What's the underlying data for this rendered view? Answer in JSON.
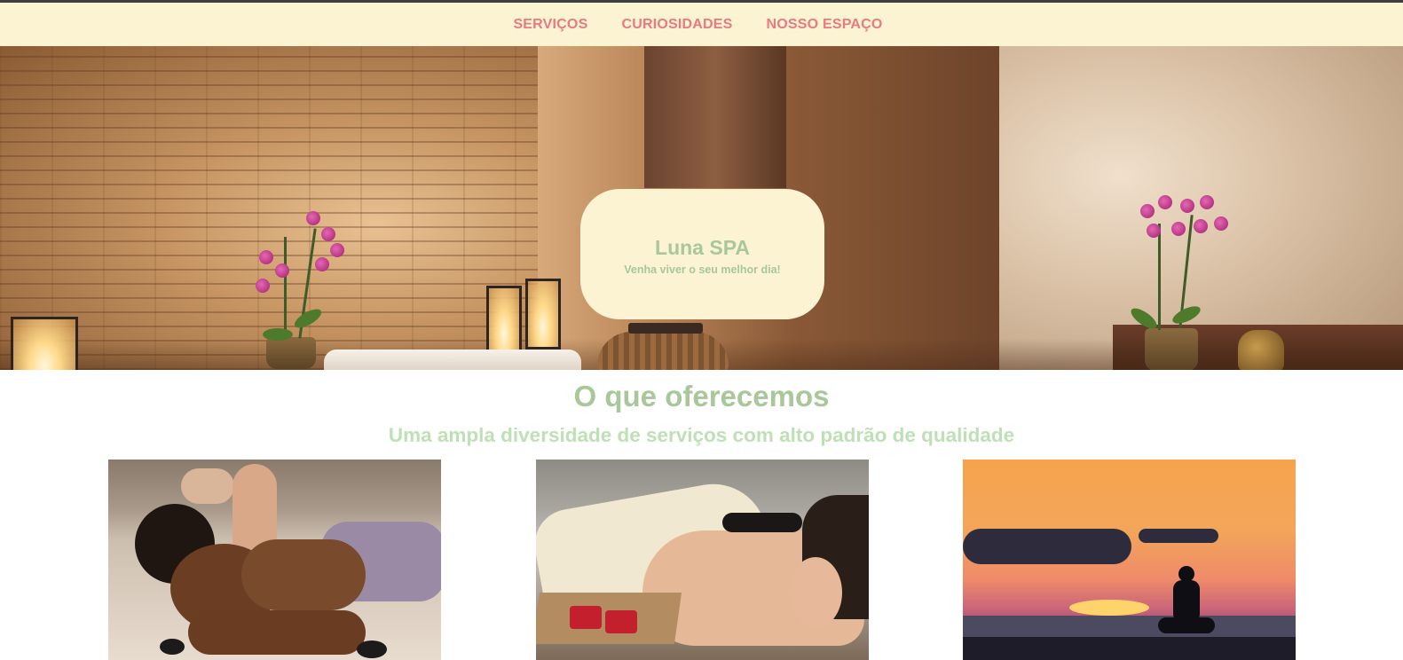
{
  "nav": {
    "items": [
      {
        "label": "SERVIÇOS"
      },
      {
        "label": "CURIOSIDADES"
      },
      {
        "label": "NOSSO ESPAÇO"
      }
    ],
    "link_color": "#e87a82",
    "background": "#fcf3d2"
  },
  "hero": {
    "title": "Luna SPA",
    "subtitle": "Venha viver o seu melhor dia!",
    "card_background": "#fcf3d2",
    "text_color": "#a8c79b"
  },
  "section": {
    "title": "O que oferecemos",
    "subtitle": "Uma ampla diversidade de serviços com alto padrão de qualidade",
    "title_color": "#a8c79b",
    "subtitle_color": "#bfe0b6"
  },
  "services": [
    {
      "image": "massage-photo"
    },
    {
      "image": "hot-stone-massage-photo"
    },
    {
      "image": "yoga-sunset-photo"
    }
  ]
}
